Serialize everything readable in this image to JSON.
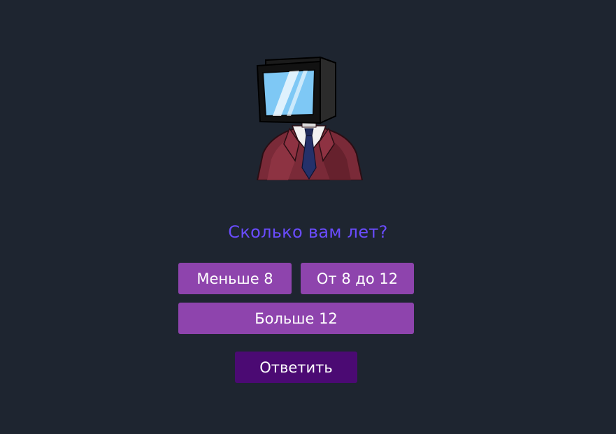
{
  "mascot": {
    "icon": "tv-head-character-icon"
  },
  "quiz": {
    "question": "Сколько вам лет?",
    "options": [
      {
        "label": "Меньше 8"
      },
      {
        "label": "От 8 до 12"
      },
      {
        "label": "Больше 12"
      }
    ],
    "submit_label": "Ответить"
  },
  "colors": {
    "background": "#1e2530",
    "question_text": "#6a4cff",
    "option_button": "#8e44ad",
    "submit_button": "#4b0a73",
    "button_text": "#ffffff"
  }
}
